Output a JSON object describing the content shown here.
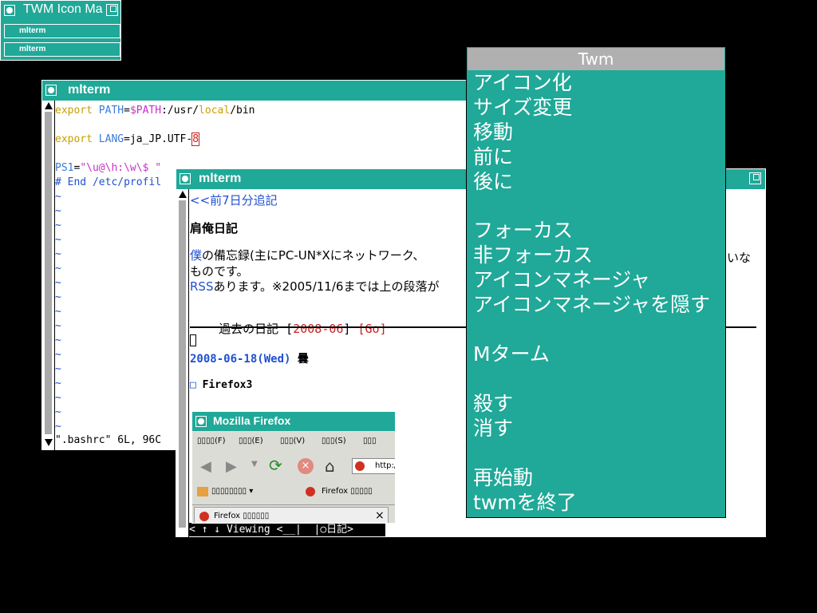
{
  "icon_manager": {
    "title": "TWM Icon Ma",
    "entries": [
      "mlterm",
      "mlterm"
    ]
  },
  "terminal_back": {
    "title": "mlterm",
    "lines": [
      {
        "parts": [
          [
            "kw",
            "export"
          ],
          [
            "",
            " "
          ],
          [
            "var",
            "PATH"
          ],
          [
            "",
            "="
          ],
          [
            "mag",
            "$PATH"
          ],
          [
            "",
            ":/usr/"
          ],
          [
            "kw",
            "local"
          ],
          [
            "",
            "/bin"
          ]
        ]
      },
      {
        "parts": []
      },
      {
        "parts": [
          [
            "kw",
            "export"
          ],
          [
            "",
            " "
          ],
          [
            "var",
            "LANG"
          ],
          [
            "",
            "=ja_JP.UTF-"
          ],
          [
            "red",
            "8"
          ]
        ]
      },
      {
        "parts": []
      },
      {
        "parts": [
          [
            "var",
            "PS1"
          ],
          [
            "",
            "="
          ],
          [
            "mag",
            "\"\\u@\\h:\\w\\$ \""
          ]
        ]
      },
      {
        "parts": [
          [
            "blu",
            "# End /etc/profil"
          ]
        ]
      }
    ],
    "tilde": "~",
    "tilde_count": 17,
    "status": "\".bashrc\" 6L, 96C"
  },
  "terminal_front": {
    "title": "mlterm",
    "prev_link": "<<前7日分追記",
    "heading": "肩俺日記",
    "desc_prefix": "僕",
    "desc_line1": "の備忘録(主にPC-UN*Xにネットワーク、",
    "desc_tail": "いな",
    "desc_line2": "ものです。",
    "rss_link": "RSS",
    "rss_text": "あります。※2005/11/6までは上の段落が",
    "archive_label": "過去の日記",
    "archive_open": " [",
    "archive_date": "2008-06",
    "archive_close": "] ",
    "archive_go": "[Go]",
    "cursor": "",
    "entry_date": "2008-06-18(Wed)",
    "entry_weather": " 曇",
    "section_mark": "□",
    "section_title": " Firefox3",
    "status_bar": "< ↑ ↓ Viewing <__|  |○日記>"
  },
  "firefox": {
    "title": "Mozilla Firefox",
    "menus": [
      "▯▯▯▯(F)",
      "▯▯▯(E)",
      "▯▯▯(V)",
      "▯▯▯(S)",
      "▯▯▯"
    ],
    "url": "http://",
    "bookmark_folder": "▯▯▯▯▯▯▯▯ ▾",
    "bookmark_item": "Firefox ▯▯▯▯▯",
    "tab_label": "Firefox ▯▯▯▯▯▯",
    "tab_close": "×"
  },
  "twm_menu": {
    "title": "Twm",
    "items": [
      "アイコン化",
      "サイズ変更",
      "移動",
      "前に",
      "後に",
      "フォーカス",
      "非フォーカス",
      "アイコンマネージャ",
      "アイコンマネージャを隠す",
      "Mターム",
      "殺す",
      "消す",
      "再始動",
      "twmを終了"
    ]
  },
  "colors": {
    "accent": "#20a898",
    "desktop": "#000000",
    "menu_title_bg": "#b0b0b0"
  }
}
